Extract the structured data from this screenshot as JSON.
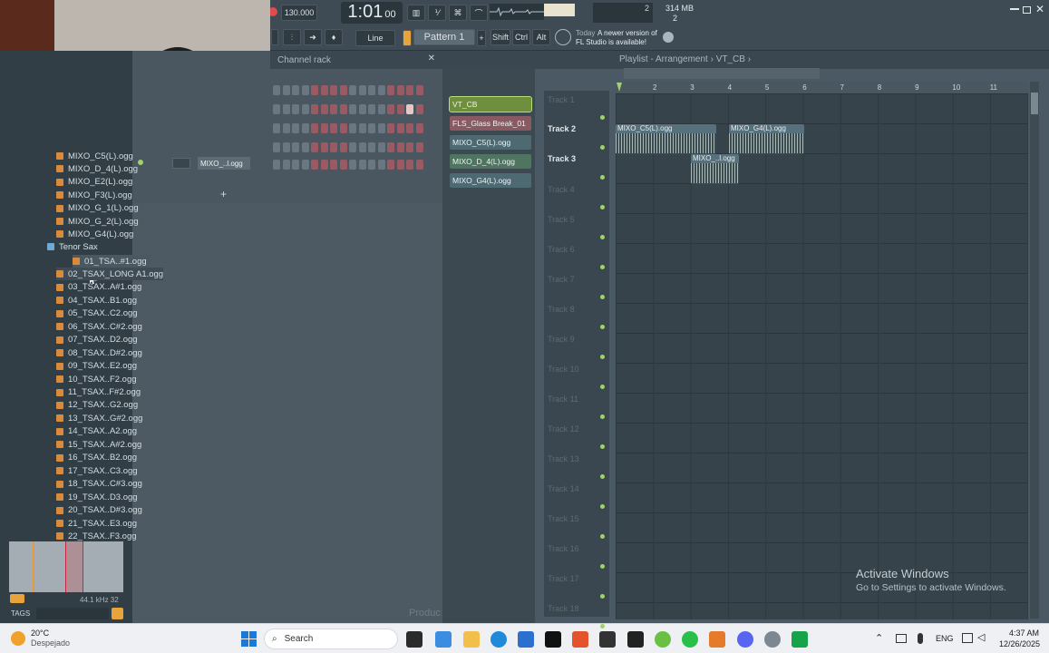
{
  "transport": {
    "tempo": "130.000",
    "time": "1:01",
    "time_sub": "00",
    "cpu": "2",
    "mem": "314 MB",
    "poly": "2"
  },
  "toolbar": {
    "snap": "Line",
    "pattern": "Pattern 1",
    "shift": "Shift",
    "ctrl": "Ctrl",
    "alt": "Alt",
    "news_day": "Today",
    "news_text": "A newer version of FL Studio is available!"
  },
  "channel_rack": {
    "title": "Channel rack",
    "channel": "MIXO_..l.ogg",
    "add": "+"
  },
  "browser": {
    "items_top": [
      "MIXO_C5(L).ogg",
      "MIXO_D_4(L).ogg",
      "MIXO_E2(L).ogg",
      "MIXO_F3(L).ogg",
      "MIXO_G_1(L).ogg",
      "MIXO_G_2(L).ogg",
      "MIXO_G4(L).ogg"
    ],
    "folder": "Tenor Sax",
    "items_sax": [
      "01_TSA..#1.ogg",
      "02_TSAX_LONG A1.ogg",
      "03_TSAX..A#1.ogg",
      "04_TSAX..B1.ogg",
      "05_TSAX..C2.ogg",
      "06_TSAX..C#2.ogg",
      "07_TSAX..D2.ogg",
      "08_TSAX..D#2.ogg",
      "09_TSAX..E2.ogg",
      "10_TSAX..F2.ogg",
      "11_TSAX..F#2.ogg",
      "12_TSAX..G2.ogg",
      "13_TSAX..G#2.ogg",
      "14_TSAX..A2.ogg",
      "15_TSAX..A#2.ogg",
      "16_TSAX..B2.ogg",
      "17_TSAX..C3.ogg",
      "18_TSAX..C#3.ogg",
      "19_TSAX..D3.ogg",
      "20_TSAX..D#3.ogg",
      "21_TSAX..E3.ogg",
      "22_TSAX..F3.ogg"
    ],
    "sample_info": "44.1 kHz 32",
    "tags": "TAGS"
  },
  "playlist": {
    "title": "Playlist - Arrangement › VT_CB ›",
    "patterns": [
      "VT_CB",
      "FLS_Glass Break_01",
      "MIXO_C5(L).ogg",
      "MIXO_D_4(L).ogg",
      "MIXO_G4(L).ogg"
    ],
    "ruler": [
      "2",
      "3",
      "4",
      "5",
      "6",
      "7",
      "8",
      "9",
      "10",
      "11"
    ],
    "tracks": [
      "Track 1",
      "Track 2",
      "Track 3",
      "Track 4",
      "Track 5",
      "Track 6",
      "Track 7",
      "Track 8",
      "Track 9",
      "Track 10",
      "Track 11",
      "Track 12",
      "Track 13",
      "Track 14",
      "Track 15",
      "Track 16",
      "Track 17",
      "Track 18"
    ],
    "clips": [
      {
        "label": "MIXO_C5(L).ogg"
      },
      {
        "label": "MIXO_G4(L).ogg"
      },
      {
        "label": "MIXO_..l.ogg"
      }
    ],
    "product_text": "Produc"
  },
  "watermark": {
    "line1": "Activate Windows",
    "line2": "Go to Settings to activate Windows."
  },
  "taskbar": {
    "temp": "20°C",
    "weather": "Despejado",
    "search": "Search",
    "lang": "ENG",
    "time": "4:37 AM",
    "date": "12/26/2025"
  },
  "colors": {
    "accent_green": "#9fd36a",
    "clip_header": "#56707c",
    "step_red": "#9a5a64",
    "step_gray": "#6a7780"
  }
}
